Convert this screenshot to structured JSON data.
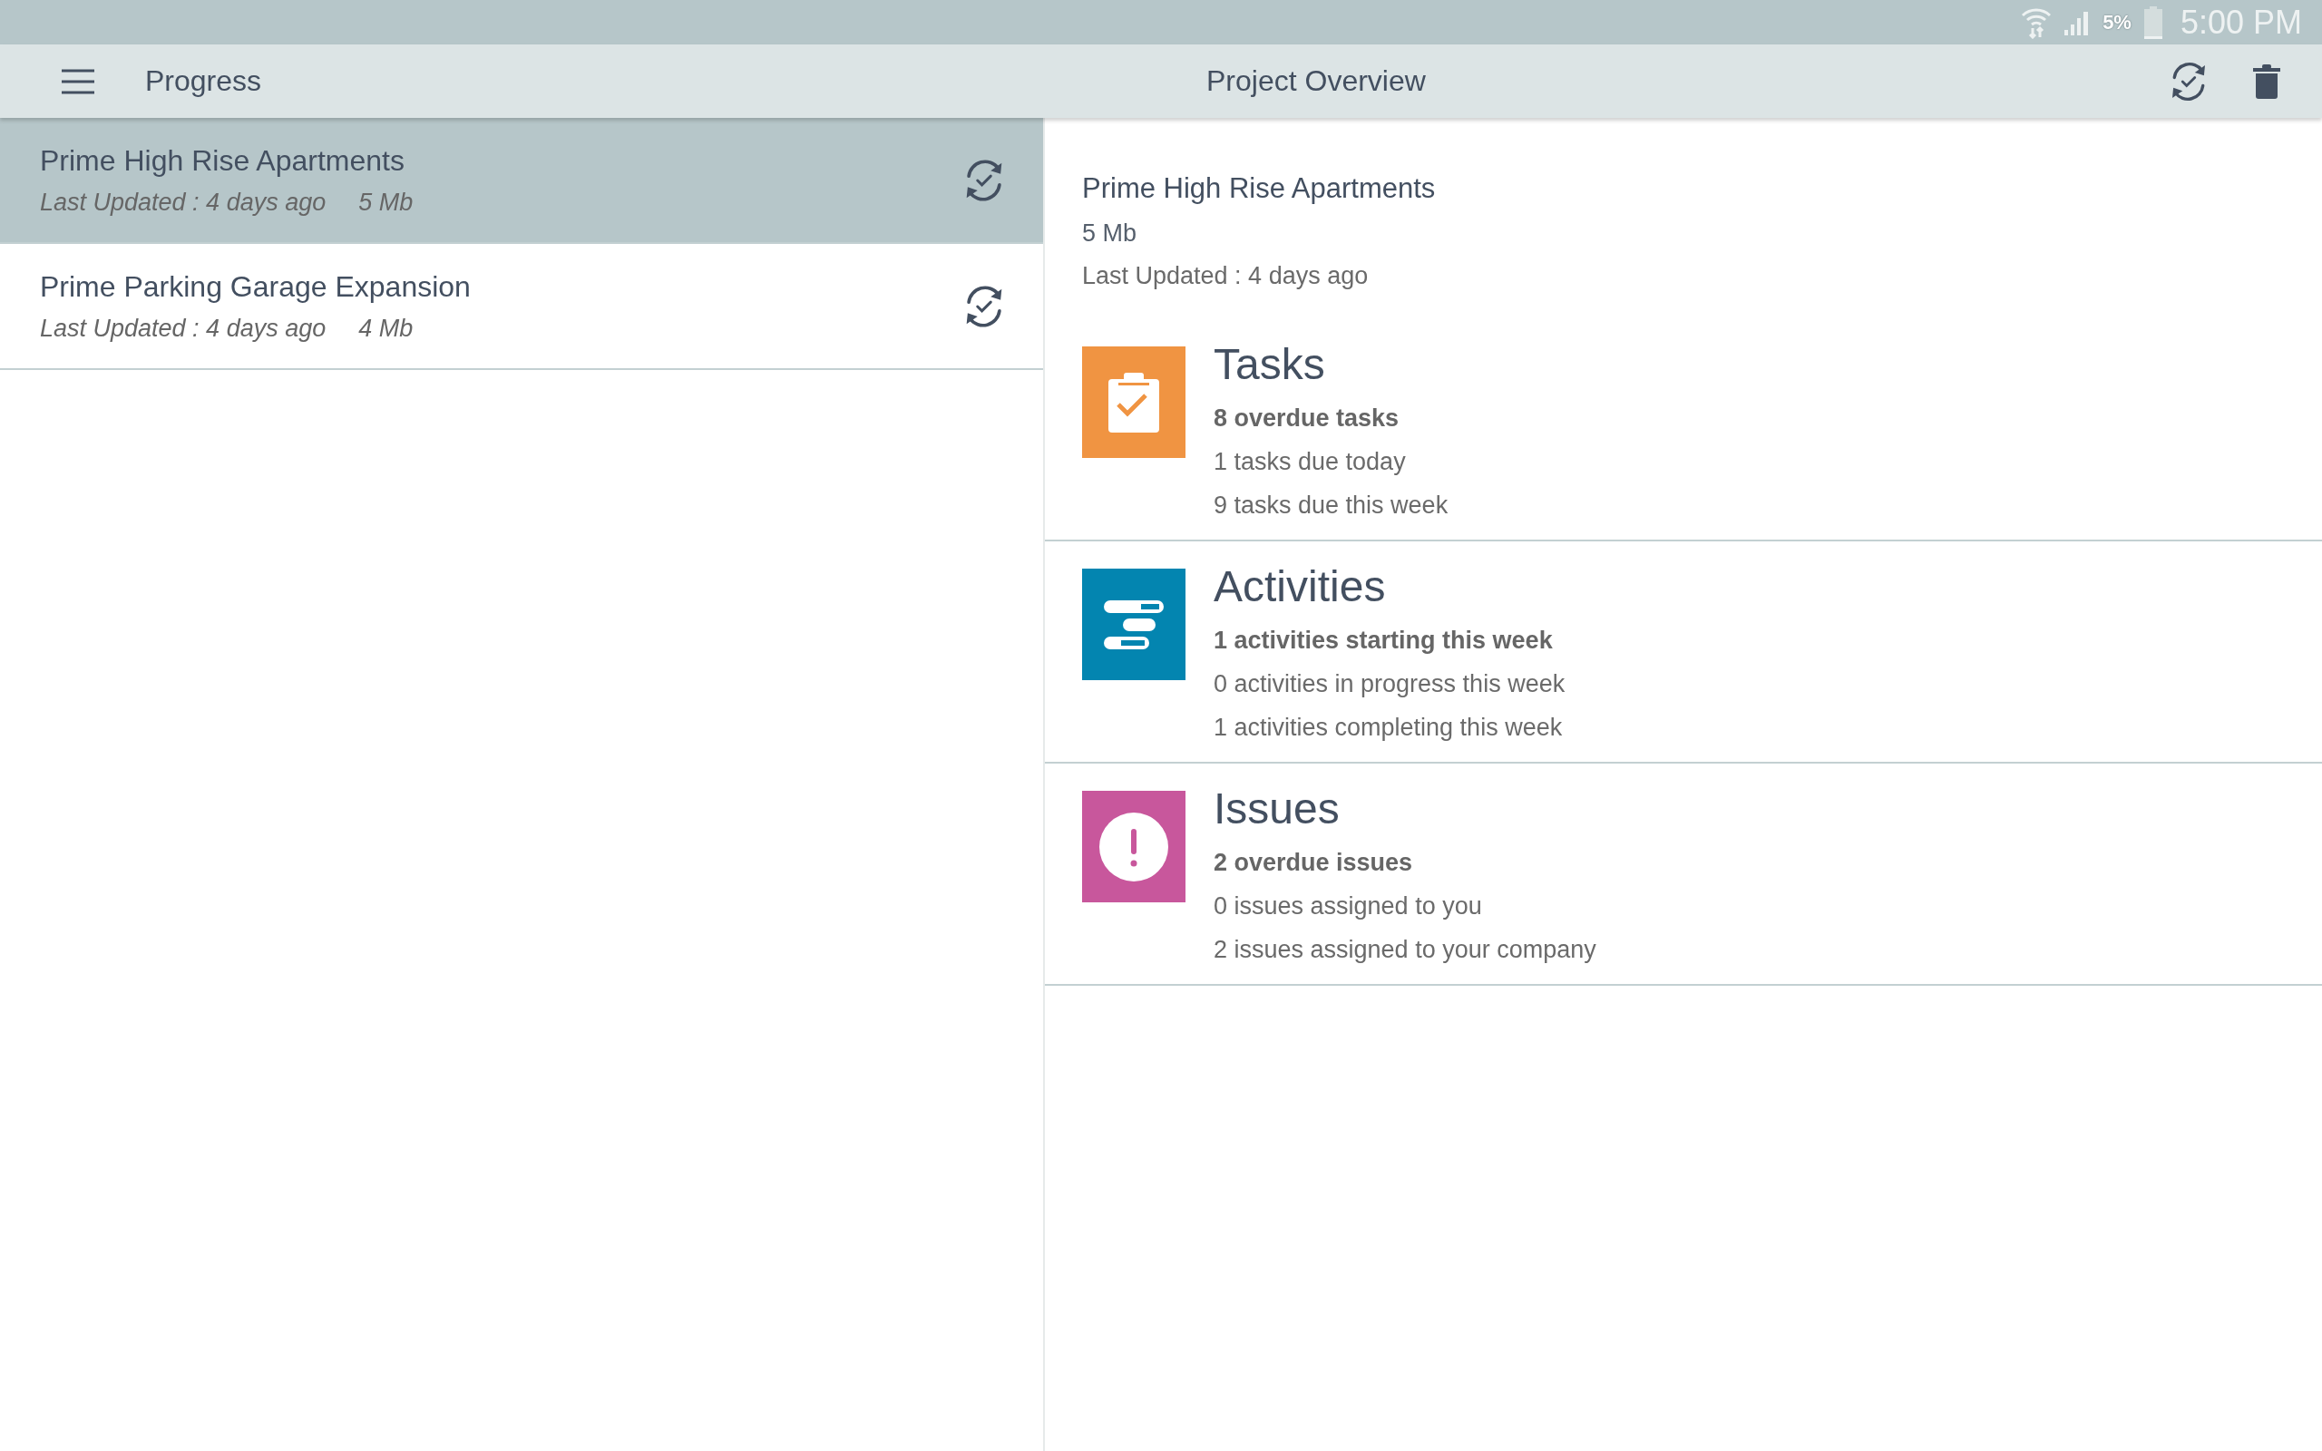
{
  "status_bar": {
    "battery": "5%",
    "time": "5:00 PM"
  },
  "app_bar": {
    "title": "Progress",
    "page_title": "Project Overview"
  },
  "projects": [
    {
      "name": "Prime High Rise Apartments",
      "updated": "Last Updated : 4 days ago",
      "size": "5 Mb",
      "selected": true
    },
    {
      "name": "Prime Parking Garage Expansion",
      "updated": "Last Updated : 4 days ago",
      "size": "4 Mb",
      "selected": false
    }
  ],
  "overview": {
    "name": "Prime High Rise Apartments",
    "size": "5 Mb",
    "updated": "Last Updated : 4 days ago",
    "cards": [
      {
        "kind": "tasks",
        "color": "#f09442",
        "title": "Tasks",
        "highlight": "8 overdue tasks",
        "details": [
          "1 tasks due today",
          "9 tasks due this week"
        ]
      },
      {
        "kind": "activities",
        "color": "#0385b0",
        "title": "Activities",
        "highlight": "1 activities starting this week",
        "details": [
          "0 activities in progress this week",
          "1 activities completing this week"
        ]
      },
      {
        "kind": "issues",
        "color": "#c8579c",
        "title": "Issues",
        "highlight": "2 overdue issues",
        "details": [
          "0 issues assigned to you",
          "2 issues assigned to your company"
        ]
      }
    ]
  }
}
